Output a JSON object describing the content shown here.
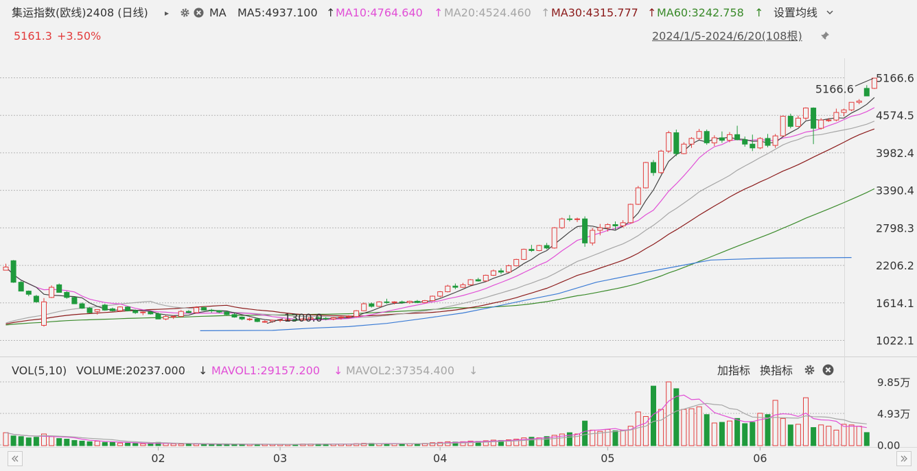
{
  "header": {
    "title": "集运指数(欧线)2408 (日线)",
    "play_icon": "▸",
    "ma_label": "MA",
    "ma5": "MA5:4937.100",
    "ma10": "MA10:4764.640",
    "ma20": "MA20:4524.460",
    "ma30": "MA30:4315.777",
    "ma60": "MA60:3242.758",
    "arrow_up": "↑",
    "settings": "设置均线",
    "price": "5161.3",
    "change": "+3.50%",
    "range": "2024/1/5-2024/6/20(108根)"
  },
  "vol_header": {
    "vol": "VOL(5,10)",
    "volume": "VOLUME:20237.000",
    "arrow_down": "↓",
    "mavol1": "MAVOL1:29157.200",
    "mavol2": "MAVOL2:37354.400",
    "add_indicator": "加指标",
    "switch_indicator": "换指标"
  },
  "colors": {
    "up": "#e23b3b",
    "down": "#1f9a3c",
    "ma5": "#404040",
    "ma10": "#e14fd6",
    "ma20": "#a6a6a6",
    "ma30": "#8b1a1a",
    "ma60": "#3a8a2a",
    "ma120": "#3a7bd5",
    "mavol1": "#e14fd6",
    "mavol2": "#a6a6a6"
  },
  "annotations": {
    "high": "5166.6",
    "low": "1300.0"
  },
  "chart_data": [
    {
      "type": "candlestick",
      "y_ticks": [
        "5166.6",
        "4574.5",
        "3982.4",
        "3390.4",
        "2798.3",
        "2206.2",
        "1614.1",
        "1022.1"
      ],
      "y_tick_values": [
        5166.6,
        4574.5,
        3982.4,
        3390.4,
        2798.3,
        2206.2,
        1614.1,
        1022.1
      ],
      "ylim": [
        1022.1,
        5166.6
      ],
      "x_ticks": [
        "02",
        "03",
        "04",
        "05",
        "06"
      ],
      "x_tick_index": [
        20,
        36,
        57,
        79,
        99
      ],
      "grid": true,
      "ohlc": [
        [
          2130,
          2233,
          2128,
          2180
        ],
        [
          2280,
          2290,
          1930,
          1940
        ],
        [
          1940,
          1960,
          1800,
          1800
        ],
        [
          1800,
          1810,
          1720,
          1750
        ],
        [
          1720,
          1740,
          1620,
          1630
        ],
        [
          1260,
          1690,
          1240,
          1630
        ],
        [
          1700,
          1890,
          1690,
          1860
        ],
        [
          1900,
          1920,
          1780,
          1780
        ],
        [
          1780,
          1800,
          1680,
          1700
        ],
        [
          1700,
          1710,
          1600,
          1600
        ],
        [
          1600,
          1620,
          1520,
          1530
        ],
        [
          1530,
          1550,
          1450,
          1460
        ],
        [
          1480,
          1510,
          1430,
          1510
        ],
        [
          1580,
          1600,
          1490,
          1500
        ],
        [
          1520,
          1540,
          1480,
          1490
        ],
        [
          1490,
          1560,
          1470,
          1550
        ],
        [
          1550,
          1560,
          1480,
          1490
        ],
        [
          1490,
          1510,
          1440,
          1460
        ],
        [
          1460,
          1480,
          1420,
          1470
        ],
        [
          1470,
          1490,
          1430,
          1440
        ],
        [
          1440,
          1460,
          1360,
          1360
        ],
        [
          1360,
          1420,
          1340,
          1400
        ],
        [
          1400,
          1420,
          1360,
          1400
        ],
        [
          1400,
          1500,
          1390,
          1480
        ],
        [
          1480,
          1500,
          1450,
          1460
        ],
        [
          1460,
          1560,
          1450,
          1540
        ],
        [
          1540,
          1560,
          1490,
          1500
        ],
        [
          1500,
          1520,
          1460,
          1490
        ],
        [
          1490,
          1500,
          1450,
          1470
        ],
        [
          1470,
          1480,
          1420,
          1430
        ],
        [
          1430,
          1450,
          1380,
          1390
        ],
        [
          1390,
          1400,
          1340,
          1360
        ],
        [
          1360,
          1380,
          1330,
          1360
        ],
        [
          1360,
          1380,
          1310,
          1320
        ],
        [
          1320,
          1340,
          1300,
          1320
        ],
        [
          1320,
          1350,
          1300,
          1340
        ],
        [
          1340,
          1360,
          1310,
          1350
        ],
        [
          1350,
          1370,
          1320,
          1350
        ],
        [
          1350,
          1370,
          1320,
          1340
        ],
        [
          1340,
          1380,
          1330,
          1360
        ],
        [
          1360,
          1390,
          1340,
          1380
        ],
        [
          1380,
          1400,
          1350,
          1370
        ],
        [
          1370,
          1390,
          1340,
          1360
        ],
        [
          1360,
          1390,
          1340,
          1380
        ],
        [
          1380,
          1400,
          1350,
          1390
        ],
        [
          1390,
          1420,
          1370,
          1400
        ],
        [
          1400,
          1500,
          1390,
          1490
        ],
        [
          1490,
          1620,
          1480,
          1600
        ],
        [
          1600,
          1620,
          1540,
          1560
        ],
        [
          1560,
          1640,
          1550,
          1630
        ],
        [
          1630,
          1680,
          1600,
          1620
        ],
        [
          1620,
          1640,
          1590,
          1630
        ],
        [
          1630,
          1650,
          1600,
          1620
        ],
        [
          1620,
          1650,
          1600,
          1640
        ],
        [
          1640,
          1660,
          1610,
          1620
        ],
        [
          1620,
          1660,
          1610,
          1650
        ],
        [
          1650,
          1730,
          1640,
          1720
        ],
        [
          1720,
          1800,
          1700,
          1790
        ],
        [
          1790,
          1900,
          1780,
          1880
        ],
        [
          1880,
          1920,
          1830,
          1860
        ],
        [
          1860,
          1930,
          1850,
          1900
        ],
        [
          1900,
          1990,
          1890,
          1980
        ],
        [
          1980,
          2010,
          1950,
          1960
        ],
        [
          1960,
          2060,
          1950,
          2050
        ],
        [
          2050,
          2140,
          2040,
          2120
        ],
        [
          2120,
          2160,
          2070,
          2100
        ],
        [
          2100,
          2220,
          2090,
          2200
        ],
        [
          2200,
          2310,
          2190,
          2300
        ],
        [
          2300,
          2470,
          2290,
          2460
        ],
        [
          2460,
          2530,
          2420,
          2440
        ],
        [
          2440,
          2530,
          2430,
          2520
        ],
        [
          2520,
          2560,
          2460,
          2480
        ],
        [
          2480,
          2810,
          2470,
          2800
        ],
        [
          2800,
          2960,
          2780,
          2940
        ],
        [
          2940,
          3000,
          2900,
          2930
        ],
        [
          2930,
          2960,
          2890,
          2940
        ],
        [
          2940,
          2980,
          2500,
          2560
        ],
        [
          2560,
          2800,
          2520,
          2760
        ],
        [
          2760,
          2860,
          2680,
          2800
        ],
        [
          2800,
          2870,
          2740,
          2850
        ],
        [
          2850,
          2900,
          2770,
          2830
        ],
        [
          2830,
          2920,
          2800,
          2880
        ],
        [
          2880,
          3180,
          2870,
          3170
        ],
        [
          3170,
          3460,
          3160,
          3430
        ],
        [
          3430,
          3840,
          3420,
          3830
        ],
        [
          3830,
          3870,
          3620,
          3670
        ],
        [
          3670,
          4030,
          3650,
          4010
        ],
        [
          4010,
          4330,
          3980,
          4300
        ],
        [
          4300,
          4350,
          3930,
          3970
        ],
        [
          3970,
          4150,
          3960,
          4120
        ],
        [
          4120,
          4230,
          4060,
          4210
        ],
        [
          4210,
          4360,
          4190,
          4320
        ],
        [
          4320,
          4350,
          4110,
          4140
        ],
        [
          4140,
          4260,
          4090,
          4220
        ],
        [
          4220,
          4320,
          4140,
          4180
        ],
        [
          4180,
          4310,
          4150,
          4270
        ],
        [
          4270,
          4410,
          4180,
          4190
        ],
        [
          4190,
          4240,
          4080,
          4120
        ],
        [
          4120,
          4270,
          4010,
          4060
        ],
        [
          4060,
          4230,
          4040,
          4210
        ],
        [
          4210,
          4280,
          4070,
          4100
        ],
        [
          4100,
          4280,
          4060,
          4250
        ],
        [
          4250,
          4570,
          4240,
          4560
        ],
        [
          4560,
          4600,
          4370,
          4400
        ],
        [
          4400,
          4570,
          4390,
          4530
        ],
        [
          4530,
          4700,
          4500,
          4690
        ],
        [
          4690,
          4700,
          4120,
          4370
        ],
        [
          4370,
          4530,
          4350,
          4500
        ],
        [
          4500,
          4530,
          4470,
          4500
        ],
        [
          4500,
          4680,
          4480,
          4620
        ],
        [
          4620,
          4680,
          4560,
          4660
        ],
        [
          4660,
          4780,
          4640,
          4780
        ],
        [
          4780,
          4830,
          4750,
          4800
        ],
        [
          5000,
          5050,
          4880,
          4880
        ],
        [
          5000,
          5166.6,
          4990,
          5161.3
        ]
      ],
      "ma120": [
        [
          31,
          1175
        ],
        [
          40,
          1178
        ],
        [
          50,
          1180
        ],
        [
          60,
          1215
        ],
        [
          70,
          1240
        ],
        [
          80,
          1290
        ],
        [
          90,
          1370
        ],
        [
          100,
          1455
        ],
        [
          108,
          1550
        ],
        [
          115,
          1640
        ],
        [
          125,
          1760
        ],
        [
          135,
          1940
        ],
        [
          150,
          2120
        ],
        [
          165,
          2290
        ],
        [
          180,
          2320
        ],
        [
          202,
          2330
        ]
      ]
    },
    {
      "type": "bar",
      "series_name": "VOLUME",
      "y_ticks": [
        "9.85万",
        "4.93万",
        "0.00"
      ],
      "ylim": [
        0,
        98500
      ],
      "volumes": [
        20000,
        15000,
        14000,
        12000,
        13000,
        18000,
        14000,
        11000,
        10000,
        8000,
        7000,
        6000,
        7000,
        5000,
        5000,
        4000,
        4000,
        3500,
        3000,
        3000,
        5000,
        3500,
        3000,
        2500,
        2500,
        2500,
        2500,
        2500,
        2000,
        2000,
        2500,
        2000,
        2000,
        2000,
        2000,
        2000,
        2000,
        2000,
        2000,
        2500,
        2500,
        2500,
        2500,
        2500,
        2500,
        2500,
        3000,
        3500,
        3500,
        3000,
        3000,
        3000,
        3000,
        3000,
        3000,
        3500,
        4500,
        5000,
        6000,
        5500,
        6000,
        7000,
        6500,
        7500,
        8500,
        8000,
        9000,
        10000,
        12000,
        13000,
        12000,
        14000,
        16000,
        18000,
        20000,
        18000,
        38000,
        24000,
        22000,
        25000,
        23000,
        24000,
        30000,
        52000,
        45000,
        92000,
        56000,
        98500,
        88000,
        56000,
        57000,
        60000,
        48000,
        35000,
        36000,
        38000,
        42000,
        34000,
        36000,
        50000,
        48000,
        70000,
        42000,
        32000,
        33000,
        74000,
        28000,
        32000,
        30000,
        24000,
        33000,
        32000,
        30000,
        20237
      ]
    }
  ]
}
